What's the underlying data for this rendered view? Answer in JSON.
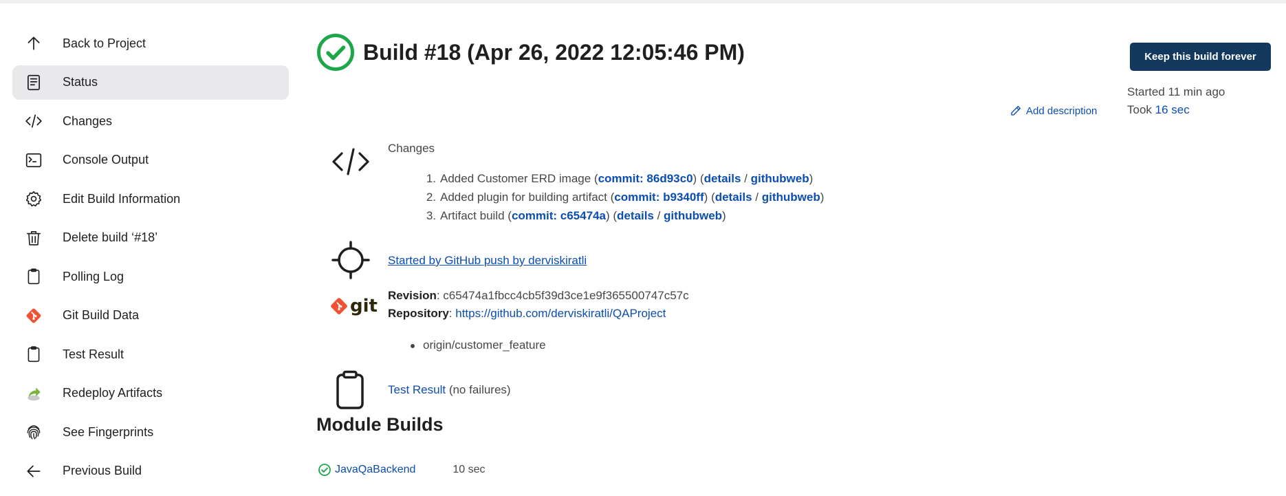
{
  "sidebar": {
    "items": [
      {
        "label": "Back to Project",
        "icon": "arrow-up-icon"
      },
      {
        "label": "Status",
        "icon": "document-icon",
        "active": true
      },
      {
        "label": "Changes",
        "icon": "code-icon"
      },
      {
        "label": "Console Output",
        "icon": "terminal-icon"
      },
      {
        "label": "Edit Build Information",
        "icon": "gear-icon"
      },
      {
        "label": "Delete build ‘#18’",
        "icon": "trash-icon"
      },
      {
        "label": "Polling Log",
        "icon": "clipboard-icon"
      },
      {
        "label": "Git Build Data",
        "icon": "git-icon"
      },
      {
        "label": "Test Result",
        "icon": "clipboard-icon"
      },
      {
        "label": "Redeploy Artifacts",
        "icon": "redeploy-icon"
      },
      {
        "label": "See Fingerprints",
        "icon": "fingerprint-icon"
      },
      {
        "label": "Previous Build",
        "icon": "arrow-left-icon"
      }
    ]
  },
  "header": {
    "title": "Build #18 (Apr 26, 2022 12:05:46 PM)",
    "keep_button": "Keep this build forever",
    "started": "Started 11 min ago",
    "took_prefix": "Took ",
    "took_value": "16 sec",
    "add_description": "Add description"
  },
  "changes": {
    "title": "Changes",
    "items": [
      {
        "num": "1.",
        "text": "Added Customer ERD image (",
        "commit": "commit: 86d93c0",
        "mid": ") (",
        "details": "details",
        "sep": " / ",
        "githubweb": "githubweb",
        "end": ")"
      },
      {
        "num": "2.",
        "text": "Added plugin for building artifact (",
        "commit": "commit: b9340ff",
        "mid": ") (",
        "details": "details",
        "sep": " / ",
        "githubweb": "githubweb",
        "end": ")"
      },
      {
        "num": "3.",
        "text": "Artifact build (",
        "commit": "commit: c65474a",
        "mid": ") (",
        "details": "details",
        "sep": " / ",
        "githubweb": "githubweb",
        "end": ")"
      }
    ]
  },
  "trigger": {
    "text": "Started by GitHub push by derviskiratli"
  },
  "git": {
    "word": "git",
    "revision_label": "Revision",
    "revision_value": ": c65474a1fbcc4cb5f39d3ce1e9f365500747c57c",
    "repository_label": "Repository",
    "repository_sep": ": ",
    "repository_url": "https://github.com/derviskiratli/QAProject",
    "branch": "origin/customer_feature"
  },
  "tests": {
    "link": "Test Result",
    "suffix": " (no failures)"
  },
  "modules": {
    "title": "Module Builds",
    "rows": [
      {
        "name": "JavaQaBackend",
        "time": "10 sec"
      }
    ]
  },
  "colors": {
    "accent": "#0b4db1",
    "button_bg": "#13395f",
    "success": "#1ea64b",
    "git_orange": "#f05133"
  }
}
